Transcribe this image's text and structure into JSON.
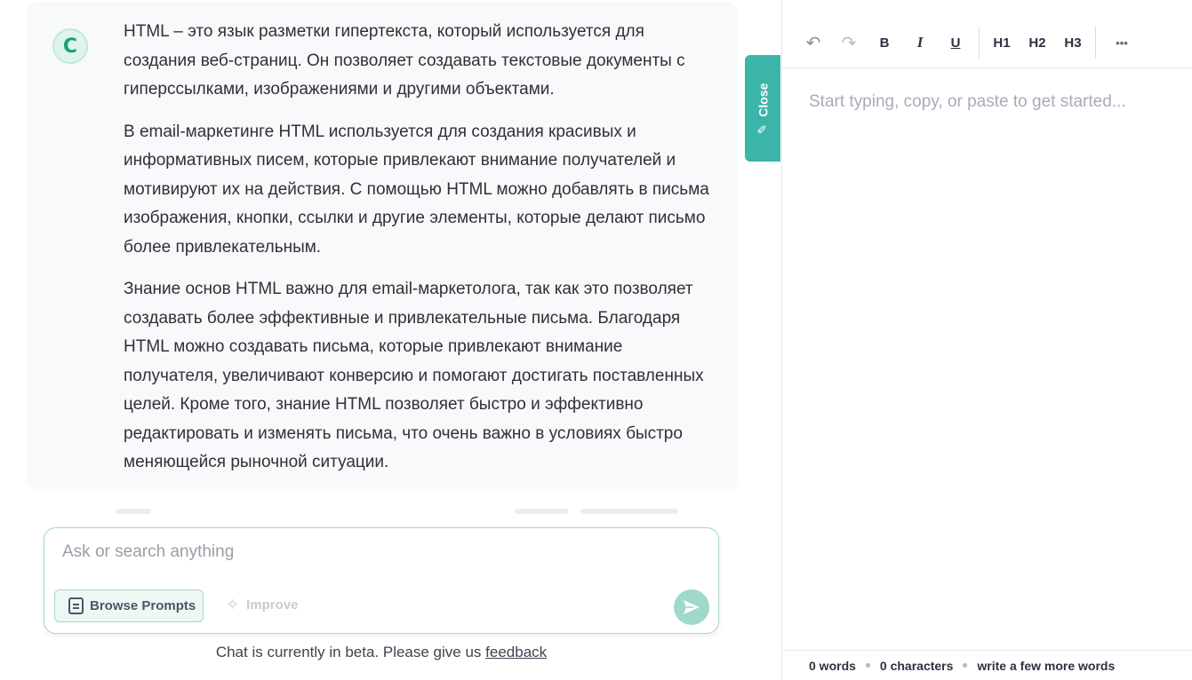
{
  "chat": {
    "avatar_letter": "C",
    "paragraphs": [
      "HTML – это язык разметки гипертекста, который используется для создания веб-страниц. Он позволяет создавать текстовые документы с гиперссылками, изображениями и другими объектами.",
      "В email-маркетинге HTML используется для создания красивых и информативных писем, которые привлекают внимание получателей и мотивируют их на действия. С помощью HTML можно добавлять в письма изображения, кнопки, ссылки и другие элементы, которые делают письмо более привлекательным.",
      "Знание основ HTML важно для email-маркетолога, так как это позволяет создавать более эффективные и привлекательные письма. Благодаря HTML можно создавать письма, которые привлекают внимание получателя, увеличивают конверсию и помогают достигать поставленных целей. Кроме того, знание HTML позволяет быстро и эффективно редактировать и изменять письма, что очень важно в условиях быстро меняющейся рыночной ситуации."
    ],
    "input_placeholder": "Ask or search anything",
    "browse_prompts_label": "Browse Prompts",
    "improve_label": "Improve",
    "beta_text": "Chat is currently in beta. Please give us ",
    "feedback_link": "feedback",
    "close_tab_label": "Close"
  },
  "editor": {
    "toolbar": {
      "undo": "↶",
      "redo": "↷",
      "bold": "B",
      "italic": "I",
      "underline": "U",
      "h1": "H1",
      "h2": "H2",
      "h3": "H3",
      "more": "•••"
    },
    "placeholder": "Start typing, copy, or paste to get started...",
    "status": {
      "words": "0 words",
      "characters": "0 characters",
      "hint": "write a few more words"
    }
  },
  "colors": {
    "accent": "#3bb5a9",
    "send_button": "#9fd9c9",
    "avatar_text": "#1aa07e"
  }
}
